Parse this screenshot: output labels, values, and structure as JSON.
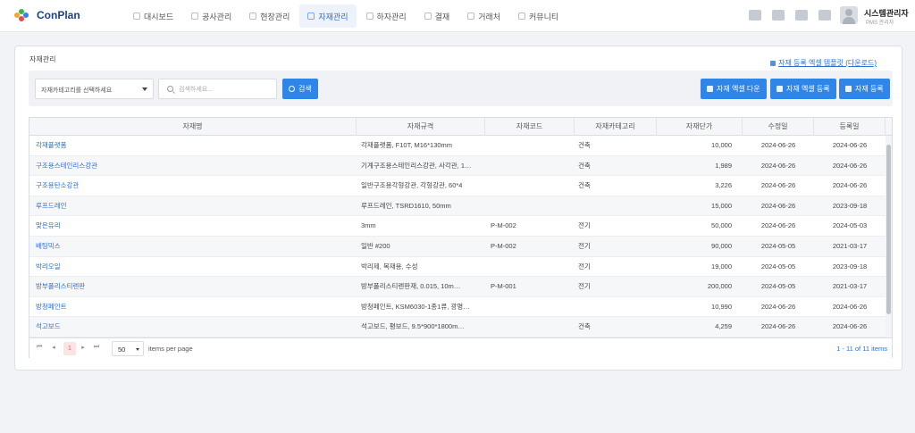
{
  "app": {
    "name": "ConPlan",
    "logo_colors": [
      "#f5a623",
      "#3ab54a",
      "#2f86e8",
      "#e94e3c"
    ]
  },
  "nav": {
    "items": [
      {
        "label": "대시보드",
        "icon": "dashboard-icon",
        "active": false
      },
      {
        "label": "공사관리",
        "icon": "construction-icon",
        "active": false
      },
      {
        "label": "현장관리",
        "icon": "site-icon",
        "active": false
      },
      {
        "label": "자재관리",
        "icon": "material-icon",
        "active": true
      },
      {
        "label": "하자관리",
        "icon": "defect-icon",
        "active": false
      },
      {
        "label": "결재",
        "icon": "approval-icon",
        "active": false
      },
      {
        "label": "거래처",
        "icon": "client-icon",
        "active": false
      },
      {
        "label": "커뮤니티",
        "icon": "community-icon",
        "active": false
      }
    ]
  },
  "user": {
    "name": "시스템관리자",
    "role": "PMS 관리자"
  },
  "page": {
    "title": "자재관리",
    "excel_template_link": "자재 등록 엑셀 템플릿 (다운로드)"
  },
  "filters": {
    "category_select": "자재카테고리를 선택하세요",
    "search_placeholder": "검색하세요...",
    "search_button": "검색"
  },
  "actions": {
    "excel_download": "자재 엑셀 다운",
    "excel_upload": "자재 엑셀 등록",
    "register": "자재 등록"
  },
  "table": {
    "columns": [
      "자재명",
      "자재규격",
      "자재코드",
      "자재카테고리",
      "자재단가",
      "수정일",
      "등록일"
    ],
    "rows": [
      [
        "각재플랫폼",
        "각재플랫폼, F10T, M16*130mm",
        "",
        "건축",
        "10,000",
        "2024-06-26",
        "2024-06-26"
      ],
      [
        "구조용스테인리스강관",
        "기계구조용스테인리스강관, 사각관, 1…",
        "",
        "건축",
        "1,989",
        "2024-06-26",
        "2024-06-26"
      ],
      [
        "구조용탄소강관",
        "일반구조용각형강관, 각형강관, 60*4",
        "",
        "건축",
        "3,226",
        "2024-06-26",
        "2024-06-26"
      ],
      [
        "루프드레인",
        "루프드레인, TSRD1610, 50mm",
        "",
        "",
        "15,000",
        "2024-06-26",
        "2023-09-18"
      ],
      [
        "맞은유리",
        "3mm",
        "P-M-002",
        "전기",
        "50,000",
        "2024-06-26",
        "2024-05-03"
      ],
      [
        "배팅믹스",
        "일반 #200",
        "P-M-002",
        "전기",
        "90,000",
        "2024-05-05",
        "2021-03-17"
      ],
      [
        "박리오일",
        "박리제, 목재용, 수성",
        "",
        "전기",
        "19,000",
        "2024-05-05",
        "2023-09-18"
      ],
      [
        "방부폴리스티렌판",
        "방부폴리스티렌판재, 0.015, 10m…",
        "P-M-001",
        "전기",
        "200,000",
        "2024-05-05",
        "2021-03-17"
      ],
      [
        "방청페인트",
        "방청페인트, KSM6030-1종1류, 광명…",
        "",
        "",
        "10,990",
        "2024-06-26",
        "2024-06-26"
      ],
      [
        "석고보드",
        "석고보드, 평보드, 9.5*900*1800m…",
        "",
        "건축",
        "4,259",
        "2024-06-26",
        "2024-06-26"
      ]
    ]
  },
  "pager": {
    "current_page": "1",
    "page_size": "50",
    "page_size_label": "items per page",
    "info": "1 - 11 of 11 items"
  }
}
